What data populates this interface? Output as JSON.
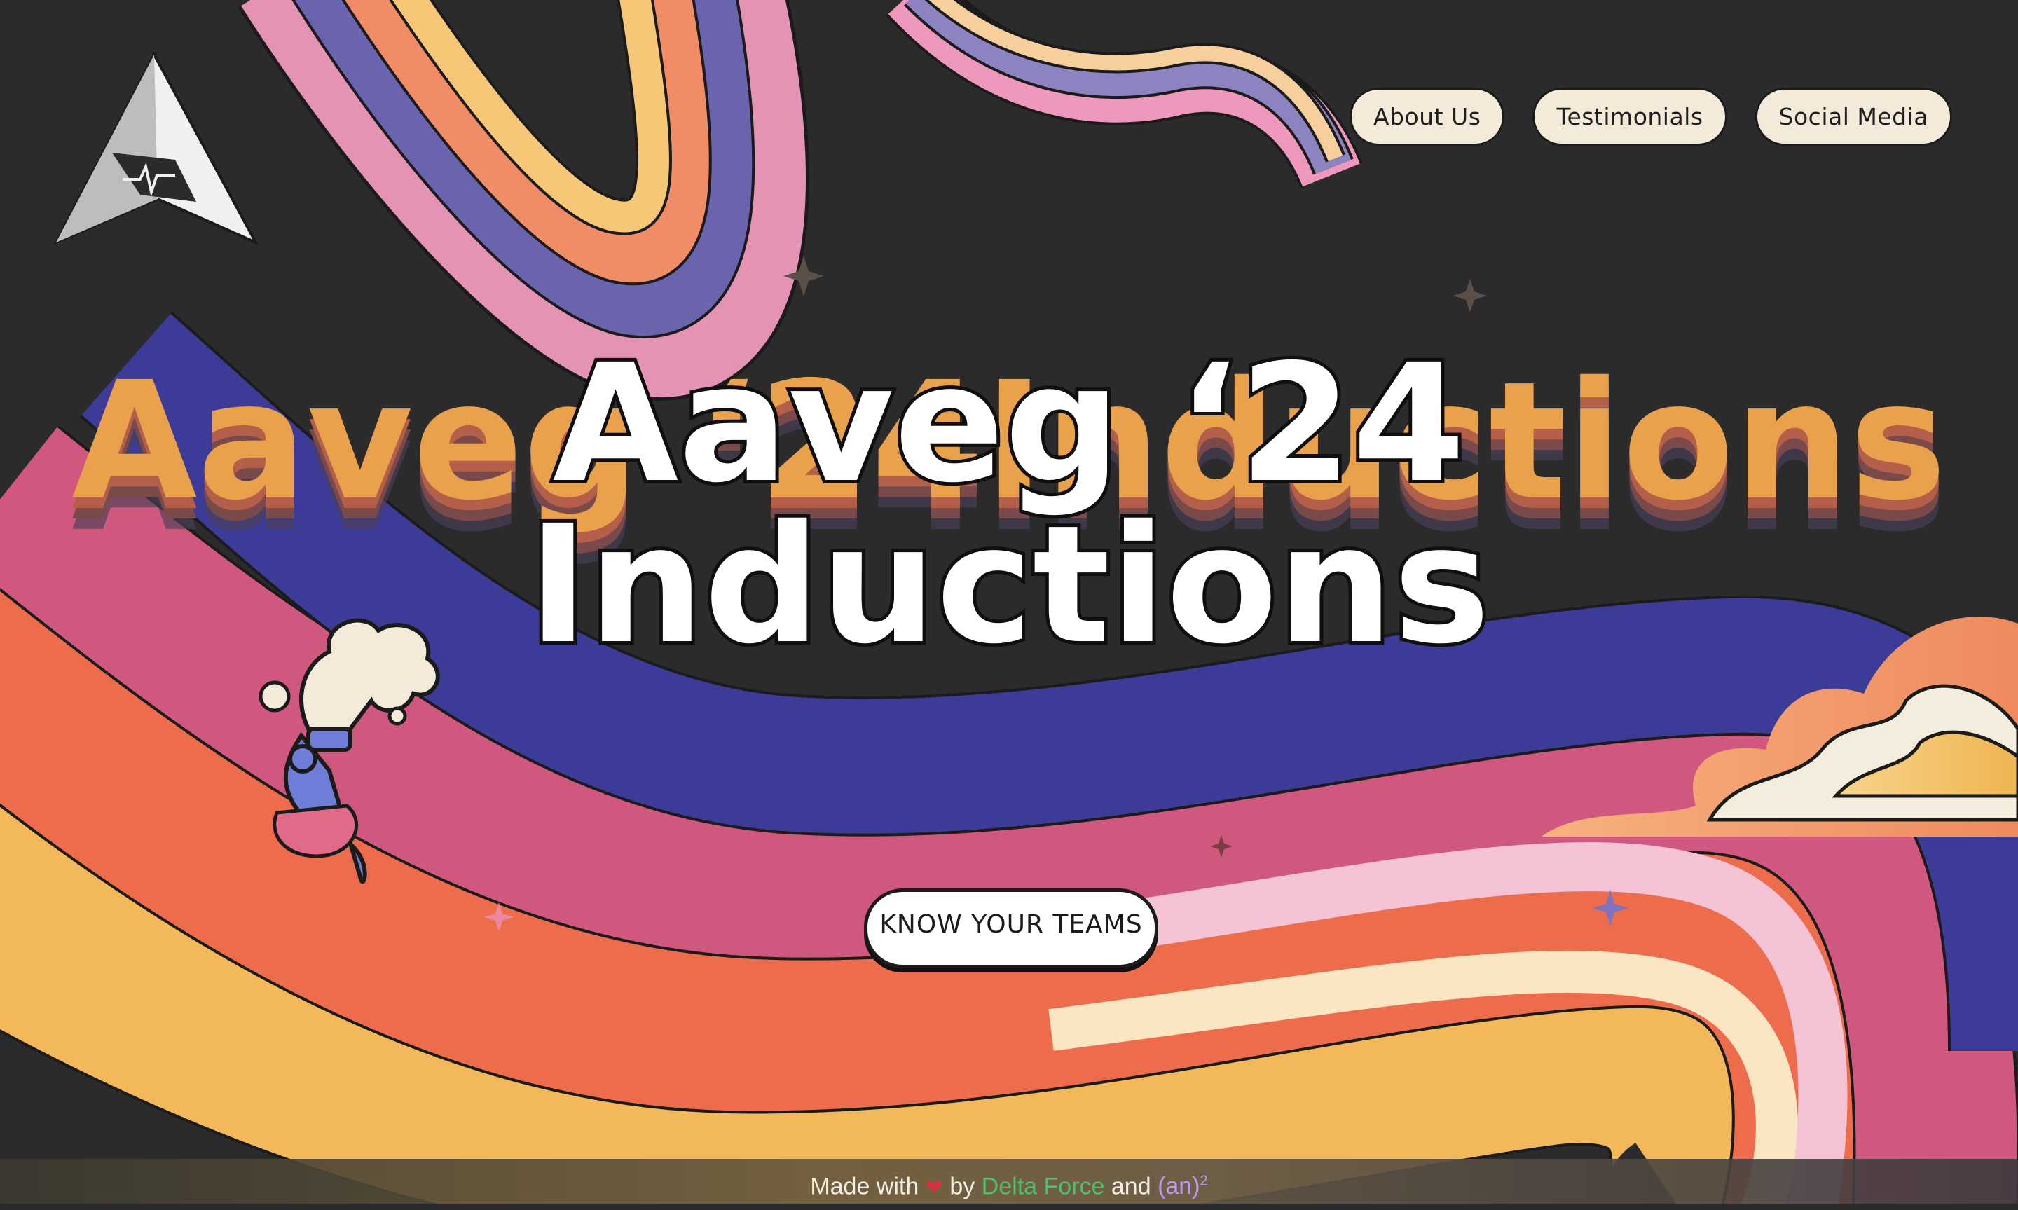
{
  "nav": {
    "items": [
      "About Us",
      "Testimonials",
      "Social Media"
    ]
  },
  "hero": {
    "title_line1": "Aaveg ‘24",
    "title_line2": "Inductions"
  },
  "cta": {
    "label": "KNOW YOUR TEAMS"
  },
  "footer": {
    "made_with": "Made with",
    "heart": "❤",
    "by": "by",
    "team1": "Delta Force",
    "and": "and",
    "team2": "(an)",
    "sup": "2"
  },
  "colors": {
    "background": "#2b2b2b",
    "rainbow_navy": "#3c3c98",
    "rainbow_pink": "#d0587e",
    "rainbow_orange": "#ec6c4c",
    "rainbow_yellow": "#f2b85a",
    "nav_button": "#f3ead9"
  }
}
